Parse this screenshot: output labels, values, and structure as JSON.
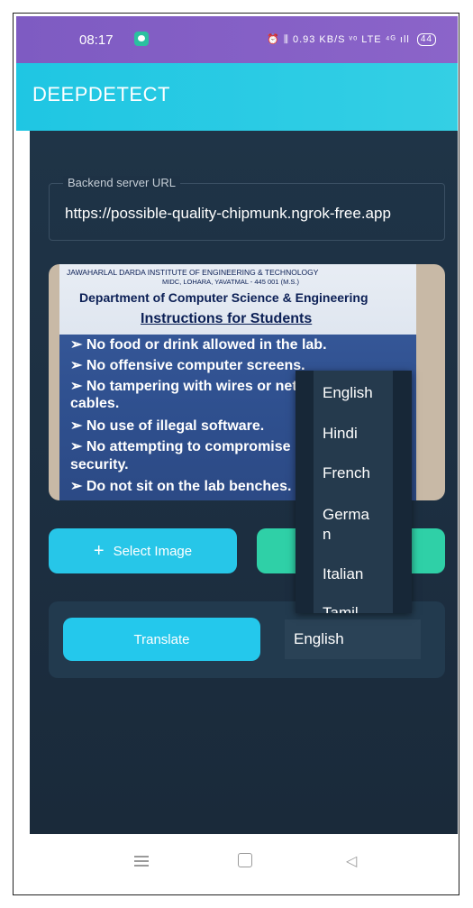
{
  "status_bar": {
    "time": "08:17",
    "right_text": "⏰ ⫼ 0.93 KB/S ᵛᵒ LTE ⁴ᴳ ıll",
    "battery": "44"
  },
  "app": {
    "title": "DEEPDETECT"
  },
  "backend": {
    "label": "Backend server URL",
    "value": "https://possible-quality-chipmunk.ngrok-free.app"
  },
  "photo": {
    "header_line1": "JAWAHARLAL DARDA INSTITUTE OF ENGINEERING & TECHNOLOGY",
    "header_line2": "MIDC, LOHARA, YAVATMAL - 445 001 (M.S.)",
    "department": "Department of Computer Science & Engineering",
    "title": "Instructions for Students",
    "rules": [
      "➢  No food or drink allowed in the lab.",
      "➢  No offensive computer screens.",
      "➢  No tampering with wires or network",
      "     cables.",
      "➢  No use of illegal software.",
      "➢  No attempting to compromise network",
      "     security.",
      "➢  Do not sit on the lab benches."
    ]
  },
  "buttons": {
    "select_image": "Select Image",
    "select_image_icon": "plus-icon",
    "translate": "Translate"
  },
  "language": {
    "selected": "English",
    "options": [
      "English",
      "Hindi",
      "French",
      "Germa\nn",
      "Italian",
      "Tamil"
    ]
  },
  "colors": {
    "status_bar": "#8b64c9",
    "app_bar": "#27c9e6",
    "content_bg": "#1f3447",
    "accent_button": "#27c6e8",
    "detect_button": "#2fd0a7"
  }
}
